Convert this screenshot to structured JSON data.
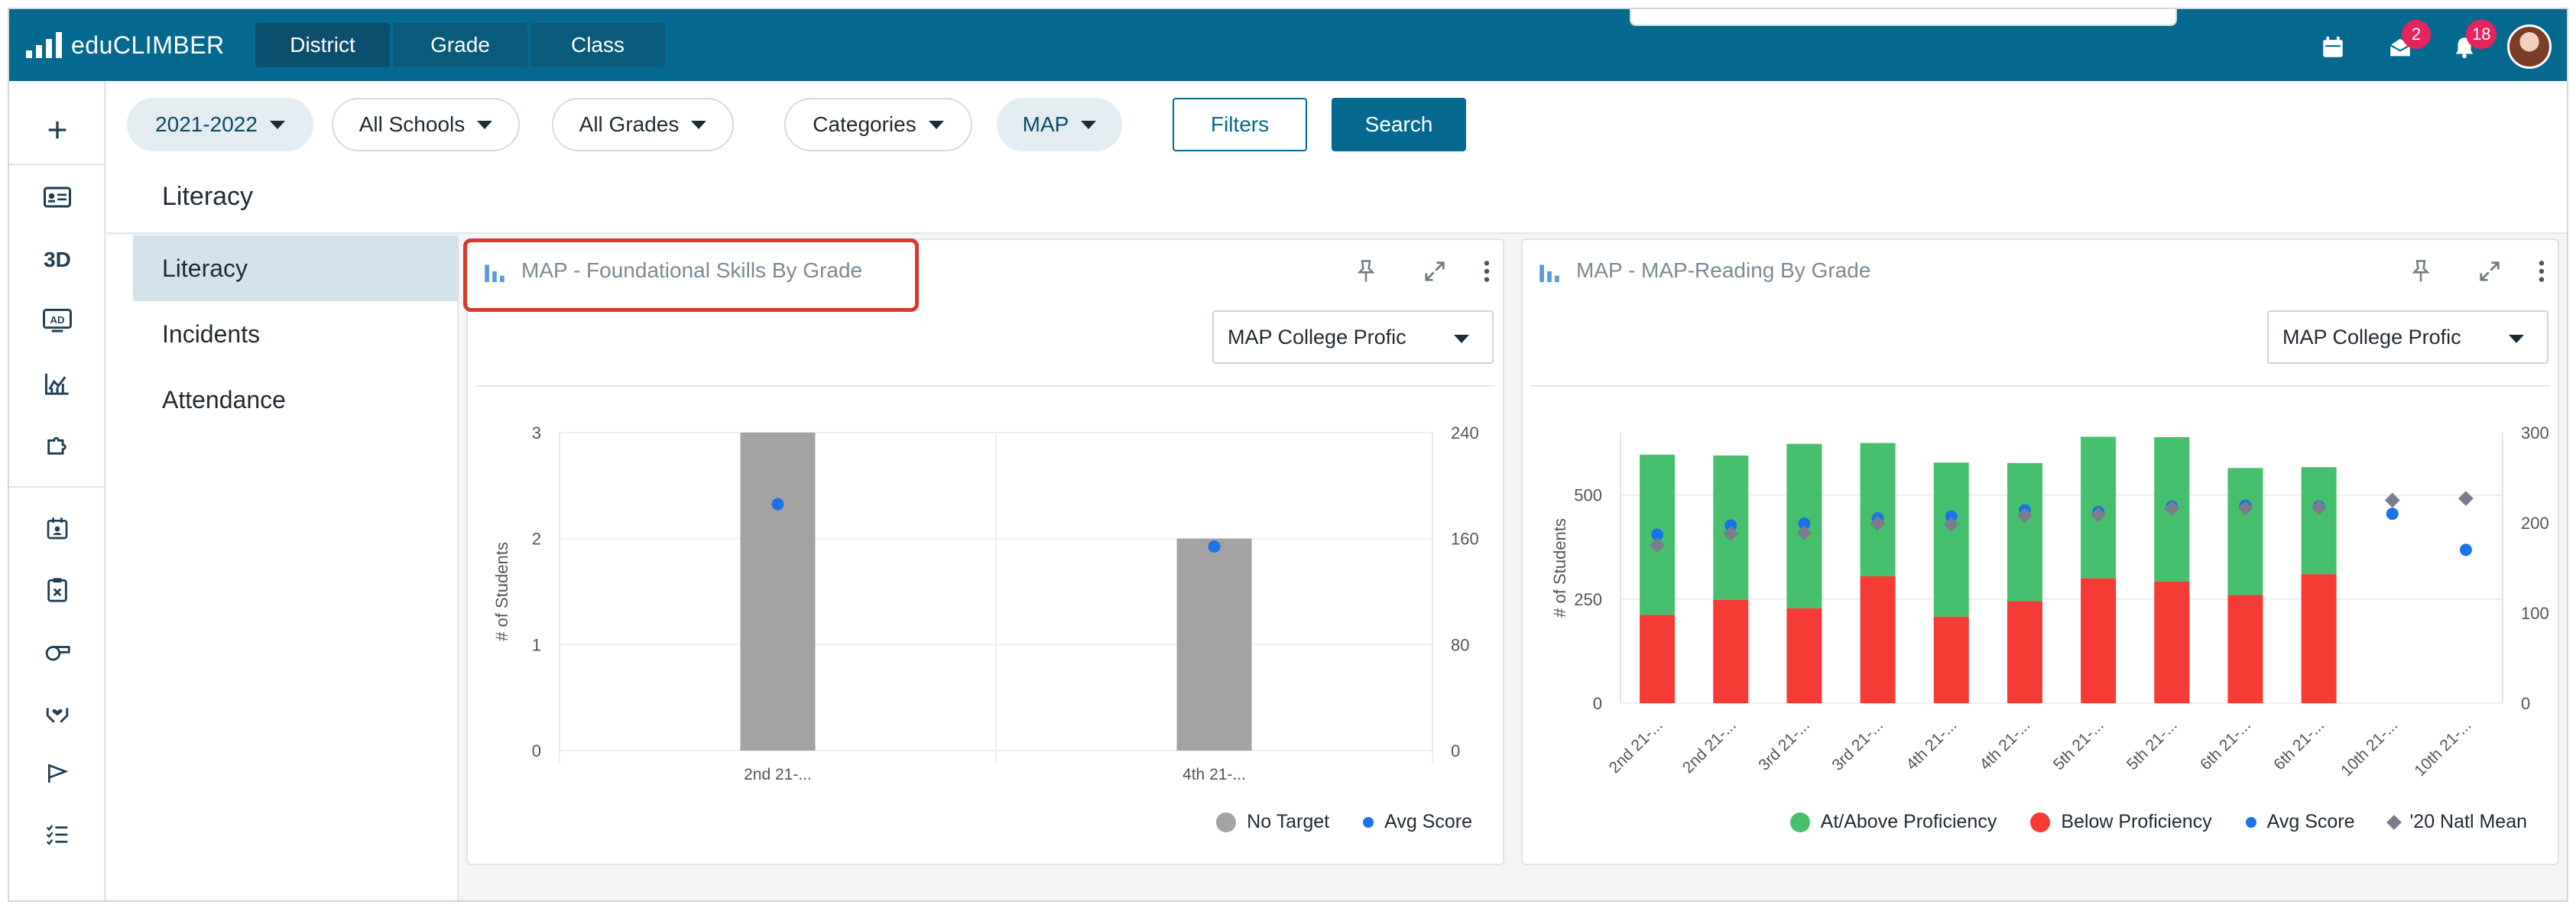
{
  "app": {
    "name": "eduCLIMBER",
    "nav_tabs": [
      {
        "label": "District"
      },
      {
        "label": "Grade"
      },
      {
        "label": "Class"
      }
    ],
    "messages_count": "2",
    "notifications_count": "18"
  },
  "rail_icons": [
    "plus-icon",
    "id-card-icon",
    "3d-text",
    "ad-icon",
    "area-chart-icon",
    "puzzle-icon",
    "calendar-user-icon",
    "clipboard-icon",
    "whistle-icon",
    "hands-heart-icon",
    "flag-icon",
    "checklist-icon"
  ],
  "rail_text": {
    "3d": "3D",
    "ad": "AD"
  },
  "filters": {
    "year": "2021-2022",
    "schools": "All Schools",
    "grades": "All Grades",
    "categories": "Categories",
    "assessment": "MAP",
    "filters_button": "Filters",
    "search_button": "Search"
  },
  "page": {
    "title": "Literacy"
  },
  "subnav": [
    {
      "label": "Literacy"
    },
    {
      "label": "Incidents"
    },
    {
      "label": "Attendance"
    }
  ],
  "panels": [
    {
      "title": "MAP - Foundational Skills By Grade",
      "select_value": "MAP College Profic",
      "legend": [
        {
          "label": "No Target",
          "color": "#a3a3a3",
          "shape": "circle"
        },
        {
          "label": "Avg Score",
          "color": "#1a73e8",
          "shape": "dot"
        }
      ]
    },
    {
      "title": "MAP - MAP-Reading By Grade",
      "select_value": "MAP College Profic",
      "legend": [
        {
          "label": "At/Above Proficiency",
          "color": "#46c06d",
          "shape": "circle"
        },
        {
          "label": "Below Proficiency",
          "color": "#f53b35",
          "shape": "circle"
        },
        {
          "label": "Avg Score",
          "color": "#1a73e8",
          "shape": "dot"
        },
        {
          "label": "'20 Natl Mean",
          "color": "#7b7d8e",
          "shape": "diamond"
        }
      ]
    }
  ],
  "chart_data": [
    {
      "type": "bar",
      "categories": [
        "2nd 21-...",
        "4th 21-..."
      ],
      "series": [
        {
          "name": "No Target",
          "values": [
            3,
            2
          ],
          "color": "#a3a3a3"
        },
        {
          "name": "Avg Score",
          "type": "scatter",
          "axis": "right",
          "values": [
            186,
            154
          ],
          "color": "#1a73e8"
        }
      ],
      "ylabel": "# of Students",
      "ylim": [
        0,
        3
      ],
      "y_ticks": [
        "0",
        "1",
        "2",
        "3"
      ],
      "y2lim": [
        0,
        240
      ],
      "y2_ticks": [
        "0",
        "80",
        "160",
        "240"
      ],
      "grid": true,
      "legend": "bottom-right"
    },
    {
      "type": "bar",
      "stacked": true,
      "categories": [
        "2nd 21-...",
        "2nd 21-...",
        "3rd 21-...",
        "3rd 21-...",
        "4th 21-...",
        "4th 21-...",
        "5th 21-...",
        "5th 21-...",
        "6th 21-...",
        "6th 21-...",
        "10th 21-...",
        "10th 21-..."
      ],
      "series": [
        {
          "name": "Below Proficiency",
          "values": [
            212,
            248,
            228,
            305,
            208,
            245,
            300,
            292,
            260,
            310,
            null,
            null
          ],
          "color": "#f53b35"
        },
        {
          "name": "At/Above Proficiency",
          "values": [
            385,
            347,
            395,
            320,
            370,
            332,
            340,
            347,
            305,
            257,
            null,
            null
          ],
          "color": "#46c06d"
        },
        {
          "name": "Avg Score",
          "type": "scatter",
          "axis": "right",
          "values": [
            187,
            197,
            199,
            205,
            207,
            214,
            212,
            218,
            219,
            218,
            210,
            170
          ],
          "color": "#1a73e8"
        },
        {
          "name": "'20 Natl Mean",
          "type": "scatter",
          "axis": "right",
          "values": [
            175,
            188,
            189,
            199,
            198,
            208,
            209,
            216,
            216,
            217,
            225,
            227
          ],
          "color": "#7b7d8e"
        }
      ],
      "ylabel": "# of Students",
      "ylim": [
        0,
        650
      ],
      "y_ticks": [
        "0",
        "250",
        "500"
      ],
      "y2lim": [
        0,
        300
      ],
      "y2_ticks": [
        "0",
        "100",
        "200",
        "300"
      ],
      "grid": true,
      "legend": "bottom-right"
    }
  ]
}
